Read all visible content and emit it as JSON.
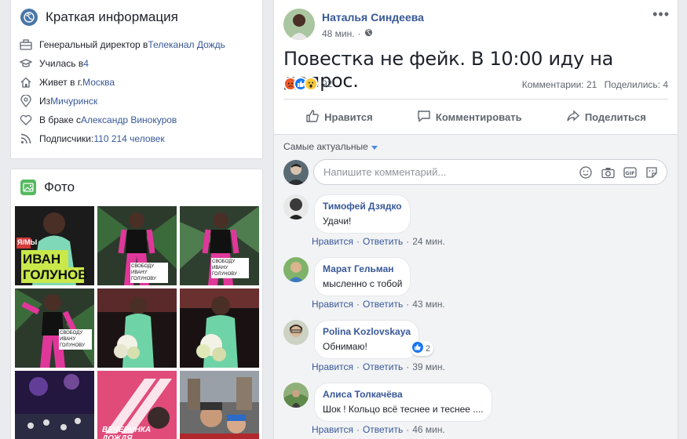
{
  "intro": {
    "title": "Краткая информация",
    "rows": [
      {
        "prefix": "Генеральный директор в ",
        "link": "Телеканал Дождь",
        "icon": "briefcase-icon"
      },
      {
        "prefix": "Училась в ",
        "link": "4",
        "icon": "graduation-cap-icon"
      },
      {
        "prefix": "Живет в г. ",
        "link": "Москва",
        "icon": "home-icon"
      },
      {
        "prefix": "Из ",
        "link": "Мичуринск",
        "icon": "location-pin-icon"
      },
      {
        "prefix": "В браке с ",
        "link": "Александр Винокуров",
        "icon": "heart-icon"
      },
      {
        "prefix": "Подписчики: ",
        "link": "110 214 человек",
        "icon": "rss-icon"
      }
    ]
  },
  "photos": {
    "title": "Фото",
    "items": [
      {
        "caption": "ИВАН ГОЛУНОВ",
        "caption_prefix": "Я/МЫ"
      },
      {
        "caption": "СВОБОДУ ИВАНУ ГОЛУНОВУ"
      },
      {
        "caption": "СВОБОДУ ИВАНУ ГОЛУНОВУ"
      },
      {
        "caption": "СВОБОДУ ИВАНУ ГОЛУНОВУ"
      },
      {
        "caption": ""
      },
      {
        "caption": ""
      },
      {
        "caption": ""
      },
      {
        "caption": "ВЕЧЕРИНКА ДОЖДЯ"
      },
      {
        "caption": ""
      }
    ]
  },
  "post": {
    "author": "Наталья Синдеева",
    "time": "48 мин.",
    "privacy_icon": "globe-icon",
    "text": "Повестка не фейк. В 10:00 иду на допрос.",
    "reaction_count": "92",
    "comments_count": "Комментарии: 21",
    "shares_count": "Поделились: 4",
    "actions": {
      "like": "Нравится",
      "comment": "Комментировать",
      "share": "Поделиться"
    },
    "sort_label": "Самые актуальные",
    "composer_placeholder": "Напишите комментарий...",
    "colors": {
      "link": "#385898",
      "like_blue": "#1877f2",
      "angry": "#f0592a",
      "wow": "#fcc83b"
    }
  },
  "comments": [
    {
      "name": "Тимофей Дзядко",
      "text": "Удачи!",
      "like": "Нравится",
      "reply": "Ответить",
      "time": "24 мин."
    },
    {
      "name": "Марат Гельман",
      "text": "мысленно с тобой",
      "like": "Нравится",
      "reply": "Ответить",
      "time": "43 мин."
    },
    {
      "name": "Polina Kozlovskaya",
      "text": "Обнимаю!",
      "like": "Нравится",
      "reply": "Ответить",
      "time": "39 мин.",
      "likes": "2"
    },
    {
      "name": "Алиса Толкачёва",
      "text": "Шок ! Кольцо всё теснее и теснее ....",
      "like": "Нравится",
      "reply": "Ответить",
      "time": "46 мин."
    }
  ]
}
